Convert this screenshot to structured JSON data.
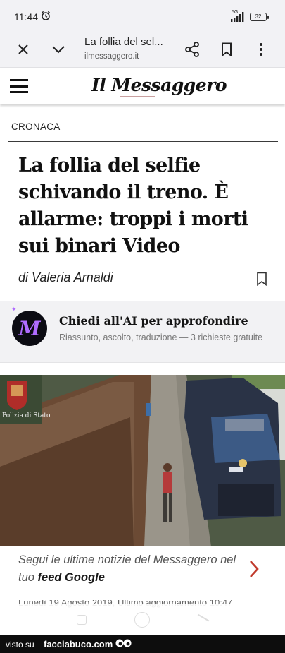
{
  "status_bar": {
    "time": "11:44",
    "network": "5G",
    "battery": "32"
  },
  "toolbar": {
    "page_title": "La follia del sel...",
    "domain": "ilmessaggero.it"
  },
  "site": {
    "logo": "Il Messaggero"
  },
  "article": {
    "section": "CRONACA",
    "headline": "La follia del selfie schivando il treno. È allarme: troppi i morti sui binari Video",
    "byline": "di Valeria Arnaldi",
    "image_caption_overlay": "Polizia di Stato"
  },
  "ai_card": {
    "title": "Chiedi all'AI per approfondire",
    "subtitle": "Riassunto, ascolto, traduzione — 3 richieste gratuite"
  },
  "feed": {
    "text_before": "Segui le ultime notizie del Messaggero nel tuo ",
    "bold": "feed Google"
  },
  "cutoff_line": "Lunedì 19 Agosto 2019, Ultimo aggiornamento 10:47",
  "watermark": {
    "prefix": "visto su",
    "site": "facciabuco.com"
  },
  "colors": {
    "accent_purple": "#b06cff",
    "feed_arrow": "#c0392b"
  }
}
